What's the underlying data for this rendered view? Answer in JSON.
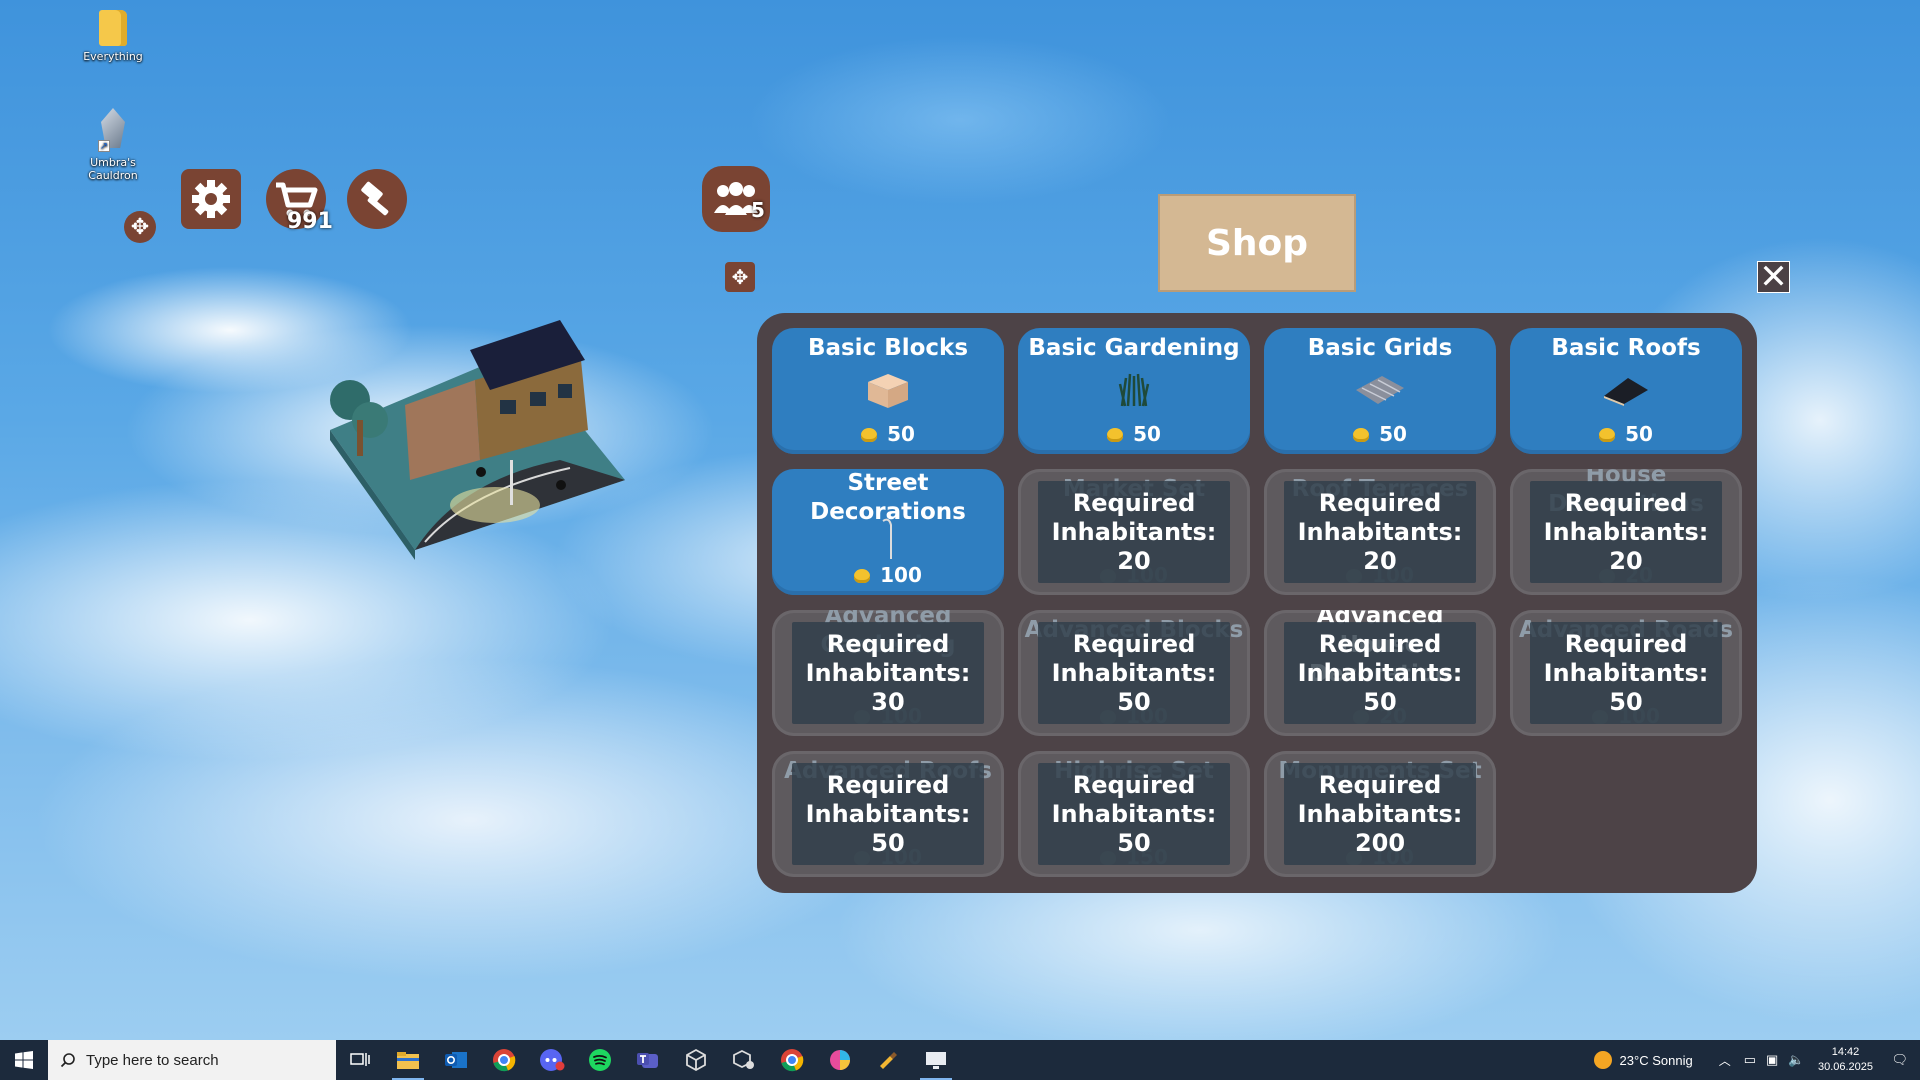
{
  "desktop": {
    "icons": [
      {
        "label": "Everything"
      },
      {
        "label": "Umbra's Cauldron"
      }
    ]
  },
  "hud": {
    "cart_count": "991",
    "inhabitants_count": "5"
  },
  "shop": {
    "title": "Shop",
    "cards": [
      {
        "title": "Basic Blocks",
        "price": "50",
        "locked": false,
        "icon": "block-icon"
      },
      {
        "title": "Basic Gardening",
        "price": "50",
        "locked": false,
        "icon": "grass-icon"
      },
      {
        "title": "Basic Grids",
        "price": "50",
        "locked": false,
        "icon": "grid-icon"
      },
      {
        "title": "Basic Roofs",
        "price": "50",
        "locked": false,
        "icon": "roof-icon"
      },
      {
        "title": "Street Decorations",
        "price": "100",
        "locked": false,
        "icon": "streetlamp-icon"
      },
      {
        "title": "Market Set",
        "price": "100",
        "locked": true,
        "requirement": "Required Inhabitants: 20"
      },
      {
        "title": "Roof Terraces",
        "price": "100",
        "locked": true,
        "requirement": "Required Inhabitants: 20"
      },
      {
        "title": "House Decorations",
        "price": "20",
        "locked": true,
        "requirement": "Required Inhabitants: 20"
      },
      {
        "title": "Advanced Gardening",
        "price": "100",
        "locked": true,
        "requirement": "Required Inhabitants: 30"
      },
      {
        "title": "Advanced Blocks",
        "price": "100",
        "locked": true,
        "requirement": "Required Inhabitants: 50"
      },
      {
        "title": "Advanced House Decoration",
        "price": "20",
        "locked": true,
        "requirement": "Required Inhabitants: 50"
      },
      {
        "title": "Advanced Roads",
        "price": "100",
        "locked": true,
        "requirement": "Required Inhabitants: 50"
      },
      {
        "title": "Advanced Roofs",
        "price": "100",
        "locked": true,
        "requirement": "Required Inhabitants: 50"
      },
      {
        "title": "Highrise Set",
        "price": "150",
        "locked": true,
        "requirement": "Required Inhabitants: 50"
      },
      {
        "title": "Monuments Set",
        "price": "100",
        "locked": true,
        "requirement": "Required Inhabitants: 200"
      }
    ]
  },
  "taskbar": {
    "search_placeholder": "Type here to search",
    "weather": "23°C  Sonnig",
    "time": "14:42",
    "date": "30.06.2025"
  },
  "colors": {
    "panel": "#4d4347",
    "card_unlocked": "#2f7ec0",
    "card_locked": "#5e5a5e",
    "hud_button": "#7a4433",
    "shop_title_bg": "#d4b893"
  }
}
